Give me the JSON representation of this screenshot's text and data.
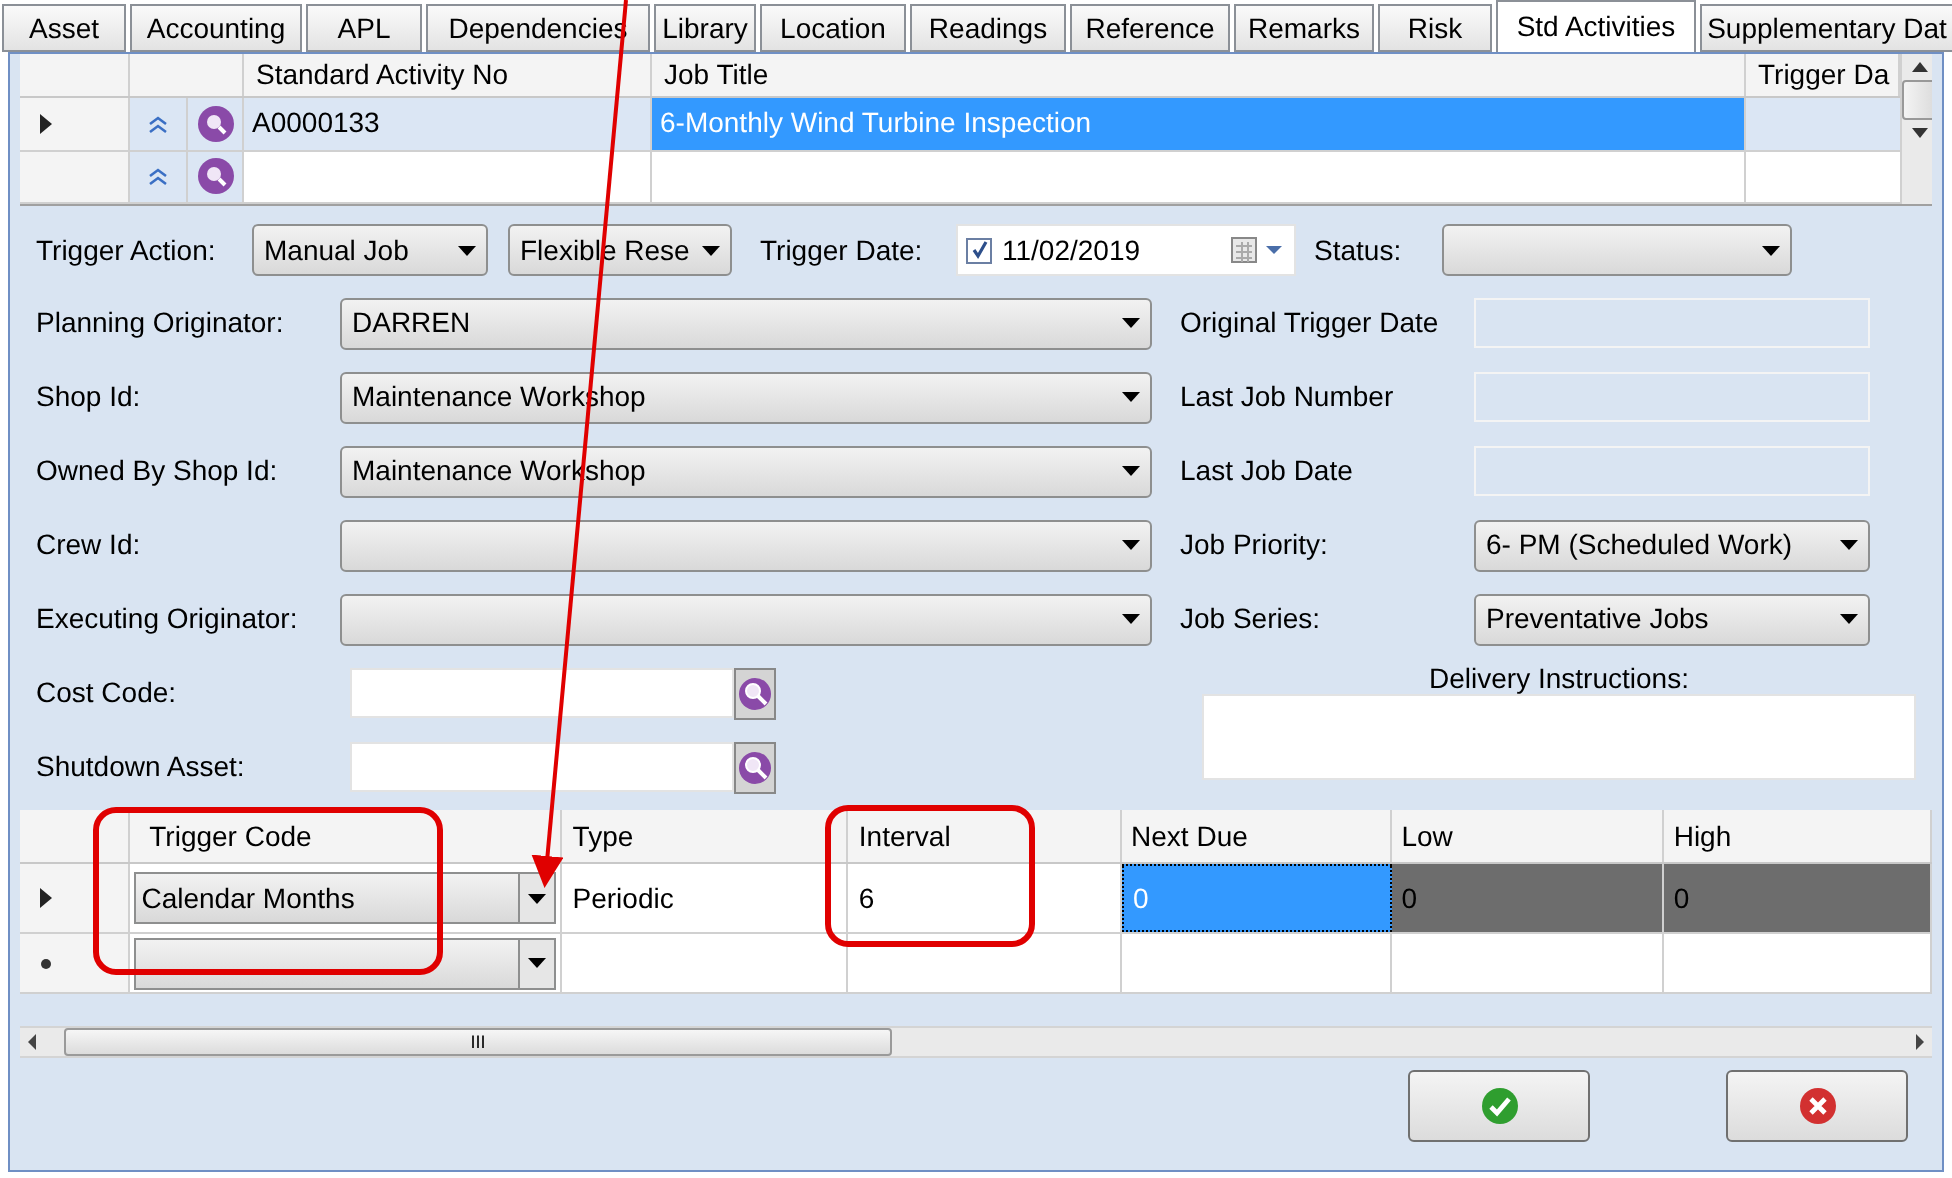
{
  "tabs": [
    {
      "label": "Asset",
      "selected": false
    },
    {
      "label": "Accounting",
      "selected": false
    },
    {
      "label": "APL",
      "selected": false
    },
    {
      "label": "Dependencies",
      "selected": false
    },
    {
      "label": "Library",
      "selected": false
    },
    {
      "label": "Location",
      "selected": false
    },
    {
      "label": "Readings",
      "selected": false
    },
    {
      "label": "Reference",
      "selected": false
    },
    {
      "label": "Remarks",
      "selected": false
    },
    {
      "label": "Risk",
      "selected": false
    },
    {
      "label": "Std Activities",
      "selected": true
    },
    {
      "label": "Supplementary Dat",
      "selected": false
    }
  ],
  "activity_grid": {
    "columns": [
      "Standard Activity No",
      "Job Title",
      "Trigger Da"
    ],
    "rows": [
      {
        "activity_no": "A0000133",
        "job_title": "6-Monthly Wind Turbine Inspection",
        "selected": true
      },
      {
        "selected": false
      }
    ]
  },
  "form": {
    "trigger_action": {
      "label": "Trigger Action:",
      "value": "Manual Job"
    },
    "reset_mode": {
      "value": "Flexible Rese"
    },
    "trigger_date": {
      "label": "Trigger Date:",
      "value": "11/02/2019",
      "checked": true
    },
    "status": {
      "label": "Status:"
    },
    "left_fields": [
      {
        "label": "Planning Originator:",
        "value": "DARREN"
      },
      {
        "label": "Shop Id:",
        "value": "Maintenance Workshop"
      },
      {
        "label": "Owned By Shop Id:",
        "value": "Maintenance Workshop"
      },
      {
        "label": "Crew Id:"
      },
      {
        "label": "Executing Originator:"
      }
    ],
    "right_fields": [
      {
        "label": "Original Trigger Date",
        "kind": "readonly"
      },
      {
        "label": "Last Job Number",
        "kind": "readonly"
      },
      {
        "label": "Last Job Date",
        "kind": "readonly"
      },
      {
        "label": "Job Priority:",
        "value": "6- PM (Scheduled Work)",
        "kind": "dropdown"
      },
      {
        "label": "Job Series:",
        "value": "Preventative Jobs",
        "kind": "dropdown"
      }
    ],
    "lookups": [
      {
        "label": "Cost Code:"
      },
      {
        "label": "Shutdown Asset:"
      }
    ],
    "delivery_instructions": {
      "label": "Delivery Instructions:"
    }
  },
  "trigger_grid": {
    "columns": [
      "Trigger Code",
      "Type",
      "Interval",
      "Next Due",
      "Low",
      "High"
    ],
    "rows": [
      {
        "trigger_code": "Calendar Months",
        "type": "Periodic",
        "interval": "6",
        "next_due": "0",
        "low": "0",
        "high": "0",
        "selected": true,
        "new_row": false
      },
      {
        "selected": false,
        "new_row": true
      }
    ]
  },
  "scrollbar_grip": "III"
}
